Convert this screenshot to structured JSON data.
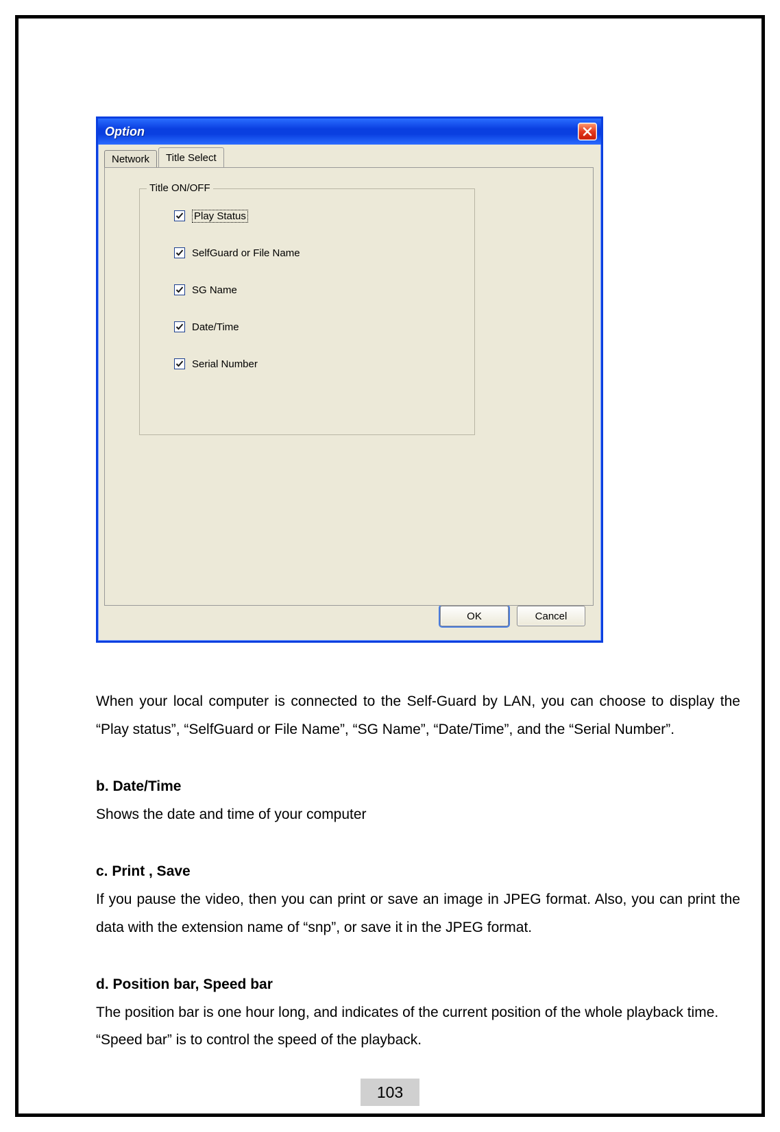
{
  "dialog": {
    "title": "Option",
    "tabs": {
      "network": "Network",
      "title_select": "Title Select"
    },
    "groupbox_label": "Title ON/OFF",
    "checkboxes": {
      "play_status": "Play Status",
      "selfguard_filename": "SelfGuard or File Name",
      "sg_name": "SG Name",
      "date_time": "Date/Time",
      "serial_number": "Serial Number"
    },
    "buttons": {
      "ok": "OK",
      "cancel": "Cancel"
    }
  },
  "doc": {
    "para1": "When your local computer is connected to the Self-Guard by LAN, you can choose to display the “Play status”, “SelfGuard or File Name”, “SG Name”, “Date/Time”, and the “Serial Number”.",
    "h_b": "b. Date/Time",
    "p_b": "Shows the date and time of your computer",
    "h_c": "c. Print , Save",
    "p_c": "If you pause the video, then you can print or save an image in JPEG format. Also, you can print the data with the extension name of “snp”, or save it in the JPEG format.",
    "h_d": "d. Position bar, Speed bar",
    "p_d": "The position bar is one hour long, and indicates of the current position of the whole playback time. “Speed bar” is to control the speed of the playback."
  },
  "page_number": "103"
}
